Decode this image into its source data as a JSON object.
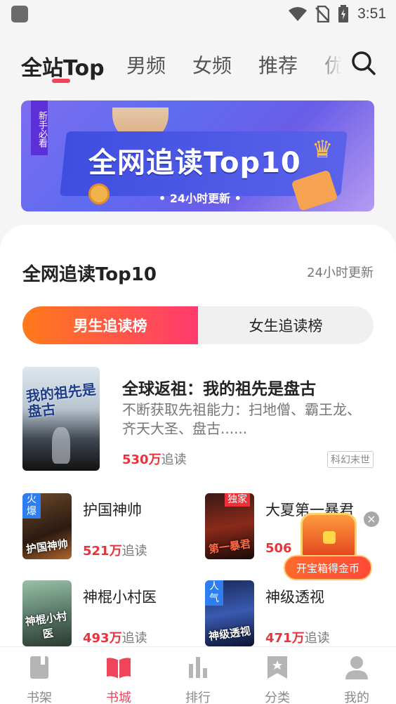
{
  "status_bar": {
    "time": "3:51"
  },
  "top_tabs": [
    {
      "label": "全站Top",
      "active": true
    },
    {
      "label": "男频"
    },
    {
      "label": "女频"
    },
    {
      "label": "推荐"
    },
    {
      "label": "优"
    }
  ],
  "banner": {
    "tag": "新手必看",
    "title": "全网追读Top10",
    "subtitle": "• 24小时更新 •"
  },
  "section": {
    "title": "全网追读Top10",
    "subtitle": "24小时更新"
  },
  "gender_switch": {
    "male": "男生追读榜",
    "female": "女生追读榜",
    "selected": "male"
  },
  "top_book": {
    "title": "全球返祖：我的祖先是盘古",
    "description": "不断获取先祖能力：扫地僧、霸王龙、齐天大圣、盘古......",
    "count_number": "530万",
    "count_suffix": "追读",
    "category": "科幻末世",
    "cover_text": "我的祖先是盘古"
  },
  "books": [
    {
      "title": "护国神帅",
      "count_number": "521万",
      "count_suffix": "追读",
      "badge": "火爆",
      "cover_text": "护国神帅"
    },
    {
      "title": "大夏第一暴君",
      "count_number": "506",
      "count_suffix": "",
      "badge": "独家",
      "cover_text": "第一暴君"
    },
    {
      "title": "神棍小村医",
      "count_number": "493万",
      "count_suffix": "追读",
      "badge": "",
      "cover_text": "神棍小村医"
    },
    {
      "title": "神级透视",
      "count_number": "471万",
      "count_suffix": "追读",
      "badge": "人气",
      "cover_text": "神级透视"
    }
  ],
  "treasure": {
    "label": "开宝箱得金币"
  },
  "bottom_nav": [
    {
      "label": "书架",
      "icon": "bookshelf-icon"
    },
    {
      "label": "书城",
      "icon": "bookstore-icon",
      "active": true
    },
    {
      "label": "排行",
      "icon": "ranking-icon"
    },
    {
      "label": "分类",
      "icon": "category-icon"
    },
    {
      "label": "我的",
      "icon": "profile-icon"
    }
  ],
  "colors": {
    "accent": "#f0445b",
    "price_red": "#e8333a",
    "switch_start": "#ff7a1a",
    "switch_end": "#ff3a6e"
  }
}
